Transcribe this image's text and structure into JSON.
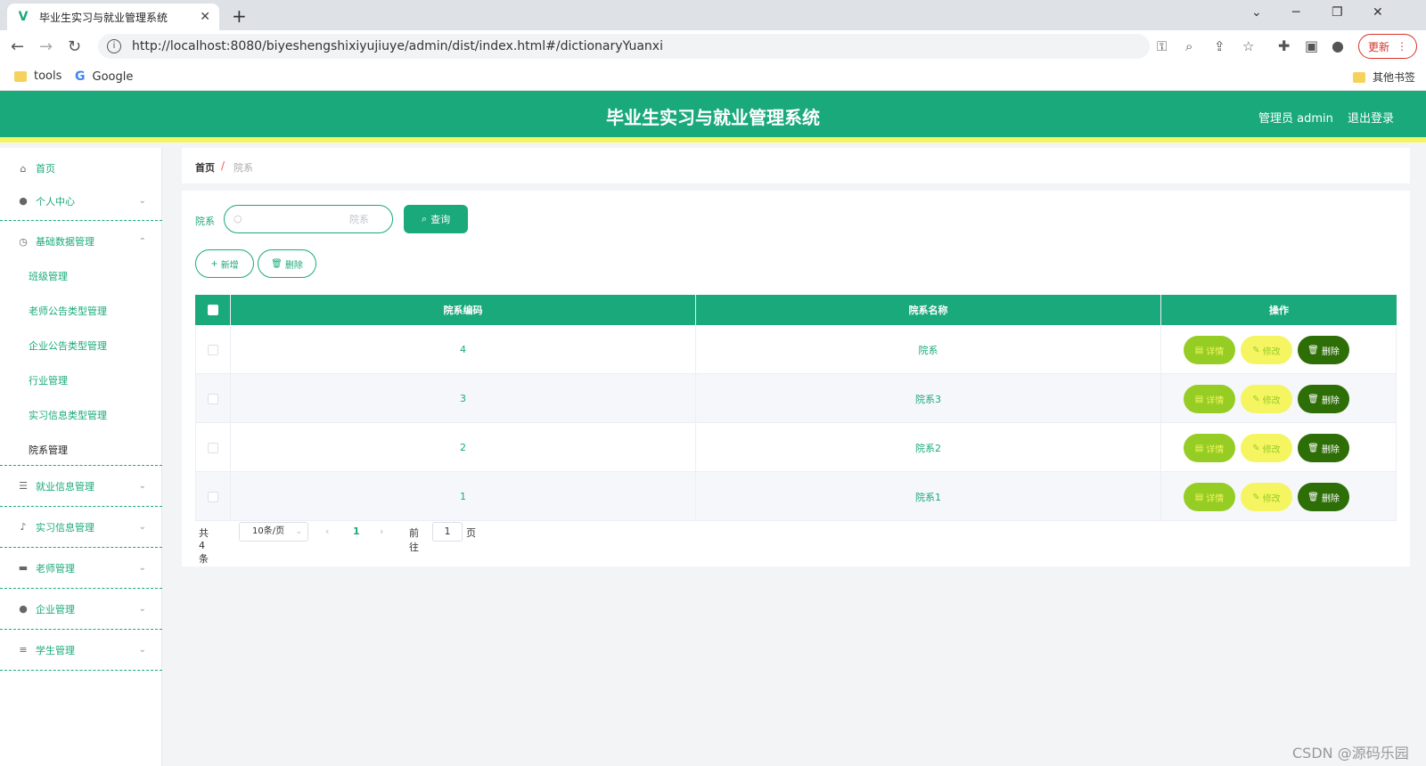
{
  "browser": {
    "tab_title": "毕业生实习与就业管理系统",
    "url": "http://localhost:8080/biyeshengshixiyujiuye/admin/dist/index.html#/dictionaryYuanxi",
    "update_label": "更新",
    "bookmarks": [
      "tools",
      "Google"
    ],
    "other_bookmarks": "其他书签"
  },
  "header": {
    "title": "毕业生实习与就业管理系统",
    "user": "管理员 admin",
    "logout": "退出登录"
  },
  "sidebar": {
    "items": [
      {
        "label": "首页",
        "icon": "home-icon"
      },
      {
        "label": "个人中心",
        "icon": "user-icon"
      },
      {
        "label": "基础数据管理",
        "icon": "clock-icon"
      },
      {
        "label": "就业信息管理",
        "icon": "list-icon"
      },
      {
        "label": "实习信息管理",
        "icon": "mic-icon"
      },
      {
        "label": "老师管理",
        "icon": "briefcase-icon"
      },
      {
        "label": "企业管理",
        "icon": "location-icon"
      },
      {
        "label": "学生管理",
        "icon": "sliders-icon"
      }
    ],
    "sub_items": [
      "班级管理",
      "老师公告类型管理",
      "企业公告类型管理",
      "行业管理",
      "实习信息类型管理",
      "院系管理"
    ]
  },
  "breadcrumb": {
    "home": "首页",
    "separator": "/",
    "current": "院系"
  },
  "search": {
    "label": "院系",
    "placeholder": "院系",
    "button": "查询"
  },
  "actions": {
    "add": "新增",
    "delete": "删除"
  },
  "table": {
    "columns": [
      "院系编码",
      "院系名称",
      "操作"
    ],
    "rows": [
      {
        "code": "4",
        "name": "院系"
      },
      {
        "code": "3",
        "name": "院系3"
      },
      {
        "code": "2",
        "name": "院系2"
      },
      {
        "code": "1",
        "name": "院系1"
      }
    ],
    "row_actions": {
      "detail": "详情",
      "edit": "修改",
      "delete": "删除"
    }
  },
  "pagination": {
    "total": "共 4 条",
    "page_size": "10条/页",
    "current_page": "1",
    "goto_label": "前往",
    "goto_value": "1",
    "page_suffix": "页"
  },
  "watermark": "CSDN @源码乐园",
  "colors": {
    "primary": "#1aa97b",
    "accent": "#f5f561",
    "detail": "#96cd25",
    "danger": "#2d6e06"
  }
}
